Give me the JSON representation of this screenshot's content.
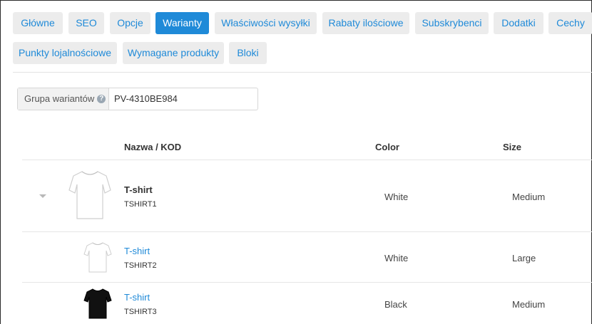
{
  "tabs": [
    {
      "label": "Główne",
      "active": false
    },
    {
      "label": "SEO",
      "active": false
    },
    {
      "label": "Opcje",
      "active": false
    },
    {
      "label": "Warianty",
      "active": true
    },
    {
      "label": "Właściwości wysyłki",
      "active": false
    },
    {
      "label": "Rabaty ilościowe",
      "active": false
    },
    {
      "label": "Subskrybenci",
      "active": false
    },
    {
      "label": "Dodatki",
      "active": false
    },
    {
      "label": "Cechy",
      "active": false
    },
    {
      "label": "Punkty lojalnościowe",
      "active": false
    },
    {
      "label": "Wymagane produkty",
      "active": false
    },
    {
      "label": "Bloki",
      "active": false
    }
  ],
  "variant_group": {
    "label": "Grupa wariantów",
    "help_icon": "question-circle-icon",
    "value": "PV-4310BE984"
  },
  "table": {
    "headers": {
      "name": "Nazwa / KOD",
      "color": "Color",
      "size": "Size"
    },
    "rows": [
      {
        "name": "T-shirt",
        "code": "TSHIRT1",
        "color": "White",
        "size": "Medium",
        "is_parent": true,
        "shirt_color": "#ffffff"
      },
      {
        "name": "T-shirt",
        "code": "TSHIRT2",
        "color": "White",
        "size": "Large",
        "is_parent": false,
        "shirt_color": "#ffffff"
      },
      {
        "name": "T-shirt",
        "code": "TSHIRT3",
        "color": "Black",
        "size": "Medium",
        "is_parent": false,
        "shirt_color": "#111111"
      }
    ]
  },
  "colors": {
    "accent": "#1f8ad8",
    "tab_bg": "#ececec"
  }
}
